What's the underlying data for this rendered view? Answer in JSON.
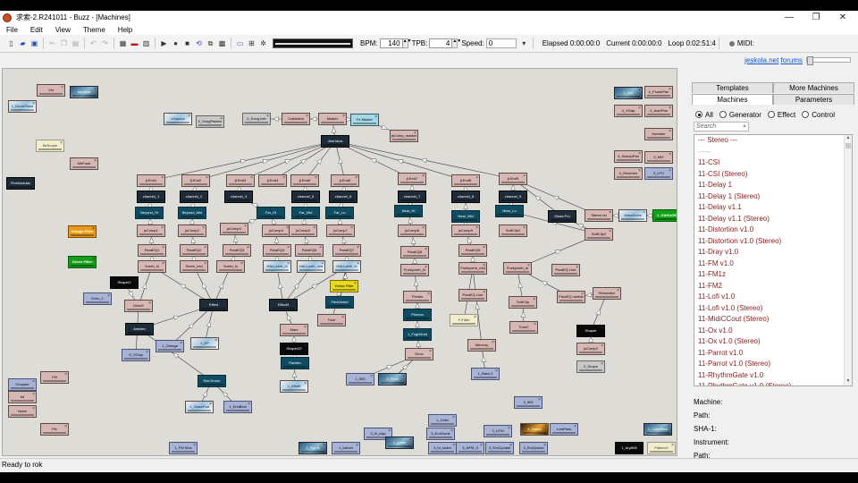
{
  "window": {
    "title": "求索-2.R241011 - Buzz - [Machines]",
    "controls": {
      "minimize": "—",
      "maximize": "❐",
      "close": "✕"
    }
  },
  "menu": [
    "File",
    "Edit",
    "View",
    "Theme",
    "Help"
  ],
  "toolbar": {
    "bpm_label": "BPM:",
    "bpm_value": "140",
    "tpb_label": "TPB:",
    "tpb_value": "4",
    "speed_label": "Speed:",
    "speed_value": "0",
    "elapsed": "Elapsed 0:00:00:0",
    "current": "Current 0:00:00:0",
    "loop": "Loop 0:02:51:4",
    "midi_label": "MIDI:"
  },
  "link": {
    "site": "jeskola.net",
    "forums": "forums"
  },
  "panel": {
    "tabs_top": [
      "Templates",
      "More Machines"
    ],
    "tabs_bottom": [
      "Machines",
      "Parameters"
    ],
    "active_tab": "Machines",
    "filters": [
      "All",
      "Generator",
      "Effect",
      "Control"
    ],
    "selected_filter": "All",
    "search_placeholder": "Search",
    "list": [
      "--- Stereo ---",
      "-----",
      "11-CSI",
      "11-CSI (Stereo)",
      "11-Delay 1",
      "11-Delay 1 (Stereo)",
      "11-Delay v1.1",
      "11-Delay v1.1 (Stereo)",
      "11-Distortion v1.0",
      "11-Distortion v1.0 (Stereo)",
      "11-Dray v1.0",
      "11-FM v1.0",
      "11-FM1z",
      "11-FM2",
      "11-Lofi v1.0",
      "11-Lofi v1.0 (Stereo)",
      "11-MidiCCout (Stereo)",
      "11-Ox v1.0",
      "11-Ox v1.0 (Stereo)",
      "11-Parrot v1.0",
      "11-Parrot v1.0 (Stereo)",
      "11-RhythmGate v1.0",
      "11-RhythmGate v1.0 (Stereo)"
    ],
    "details": [
      "Machine:",
      "Path:",
      "SHA-1:",
      "Instrument:",
      "Path:"
    ]
  },
  "status": "Ready to rok",
  "machines": {
    "master": "Master",
    "jeskola": "Jest kkva",
    "fx": "Fx Master",
    "conv": "1_Convert",
    "comp_master": "jsComp_master",
    "song_info": "0_Song Info",
    "song_pattern": "0_SongPattern",
    "x_space": "xXspace",
    "cathedral": "Cathedral",
    "vst": "Vst",
    "membra": "Membra",
    "drum_glass": "1_DrumGlass",
    "bz_scope": "BzScope",
    "mefune": "MeFune",
    "flexmod": "FlexModular",
    "orange_filter": "Orange Filter",
    "green_filter": "Green Filter",
    "shaper2": "Shaper2",
    "drive2": "Drive2",
    "s_clap": "S_SClap",
    "ambien": "Ambien",
    "omega": "1_Omega",
    "ep": "1_EP",
    "noise": "Noise",
    "fm": "FM",
    "bd": "bd",
    "chopper": "Chopper",
    "fm_sine": "1_FM Sine",
    "p_fx": "Pfx",
    "echo_1": "Echo_1",
    "synth_b": "1_Syn B",
    "l1": "jt.End1",
    "l2": "jt.End2",
    "l3": "jt.End3",
    "l4": "jt.End4",
    "l5": "jt.End5",
    "l6": "jt.End6",
    "l7": "jt.End7",
    "l8": "jt.End8",
    "l9": "jt.End9",
    "ch1": "channel_1",
    "ch2": "channel_2",
    "ch3": "channel_3",
    "ch5": "channel_5",
    "ch6": "channel_6",
    "ch7": "channel_7",
    "ch8": "channel_8",
    "ch9": "channel_9",
    "beyond_hi": "Beyond_Hi",
    "beyond_mid": "Beyond_Mid",
    "beyond_lo": "Beyond_Lo",
    "far_hi": "Far_Hi",
    "far_mid": "Far_Mid",
    "far_lo": "Far_Lo",
    "near_hi": "Near_Hi",
    "near_mid": "Near_Mid",
    "near_lo": "Near_Lo",
    "comp1": "jsComp1",
    "comp2": "jsComp2",
    "comp3": "jsComp3",
    "comp4": "jsComp4",
    "comp5": "jsComp5",
    "comp7": "jsComp7",
    "comp8": "jsComp8",
    "comp9": "jsComp9",
    "peq1": "ParaEQ1",
    "peq2": "ParaEQ2",
    "peq3": "ParaEQ3",
    "peq4": "ParaEQ4",
    "peq5": "ParaEQ5",
    "peq7": "ParaEQ7",
    "peq8": "ParaEQ8",
    "peq9": "ParaEQ9",
    "sverb_hi": "Sverb_hi",
    "sverb_mid": "Sverb_mid",
    "sverb_lo": "Sverb_lo",
    "hall_hi": "HALLverb_hi",
    "hall_mid": "HALLverb_mid",
    "hall_lo": "HALLverb_lo",
    "funky_hi": "Funkyverb_hi",
    "funky_mid": "Funkyverb_mid",
    "funky_lo": "Funkyverb_lo",
    "yellow_filter": "Yellow Filter",
    "flexdist": "FlexDistort",
    "tone": "Tone",
    "effect": "Effect",
    "effect2": "Effect3",
    "mars": "Mars",
    "shaper22": "Shaper22",
    "panisto": "Panisto",
    "khalif": "1_Khalif",
    "dist_drone": "Dist Drone",
    "glass_pad": "1_GlassPad",
    "endblod": "1_EndBlod",
    "pesitm": "Pesitm",
    "phonon": "Phonon",
    "bass_909": "1_909",
    "foghunt": "1_FoghHunt",
    "para_clg": "ParaEQ Line",
    "filter_x": "F-Filter",
    "mercury": "Mercury",
    "drive": "Drive",
    "bass_2": "1_Bass 2",
    "softclip": "SoftClip",
    "tone2": "Tone2",
    "para_rumble": "ParaEQ rumble",
    "shaper": "Shaper",
    "comp_s2": "jsComp2",
    "resonator": "Resonator",
    "comp_tiled": "SoftClip2",
    "glass_pro": "Glass Pro",
    "stereo_bd": "Stereo bd",
    "wavedrive": "WaveDrive",
    "garage": "1_GARAGE",
    "x_scope": "0_Scope",
    "power_pan": "4_PowerPan",
    "auto_pan": "4_AutoPan",
    "x_gap": "4_XGap",
    "voxmix": "1_Vox",
    "sweep_pan": "4_SweepPan",
    "mix_x": "3_MIX",
    "reverser": "4_Reverser",
    "lfo_x": "3_LFO",
    "hamster": "Hamster",
    "cello": "1_Cello",
    "x_cello": "1_CelloBass",
    "hihat_909": "3_909",
    "hi_clap": "3_hi_clap",
    "erodrone": "3_EroDrone",
    "utm": "3_UTM",
    "sword": "3_Sword",
    "lowpass": "LowPass",
    "hi_snare": "3_hi_snare",
    "nfm_3": "3_NFM_3",
    "ero_cymbal": "3_EroCymbal",
    "ero_qwe": "3_EroQwave",
    "pivot": "3_Pivot",
    "arp_808": "1_Arp808",
    "pattern_x": "PatternX",
    "bassdrum": "1_bdrum",
    "guitar_x": "1_guitar"
  }
}
